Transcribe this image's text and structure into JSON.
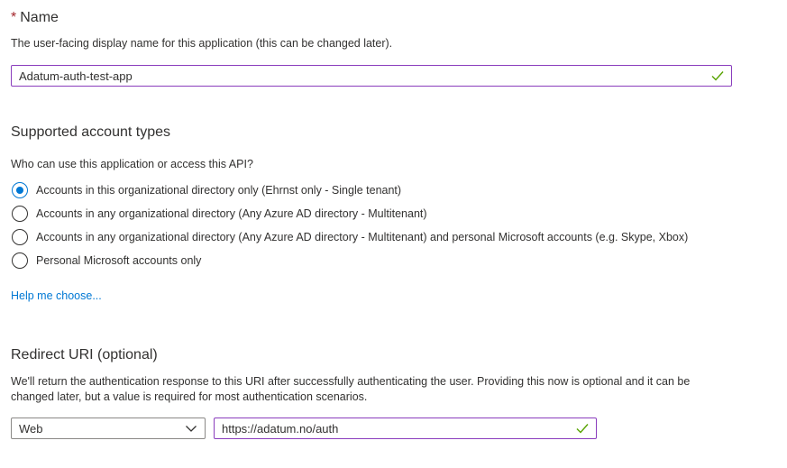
{
  "name_section": {
    "required_marker": "*",
    "title": "Name",
    "description": "The user-facing display name for this application (this can be changed later).",
    "input_value": "Adatum-auth-test-app"
  },
  "account_types": {
    "title": "Supported account types",
    "question": "Who can use this application or access this API?",
    "options": [
      {
        "label": "Accounts in this organizational directory only (Ehrnst only - Single tenant)",
        "selected": true
      },
      {
        "label": "Accounts in any organizational directory (Any Azure AD directory - Multitenant)",
        "selected": false
      },
      {
        "label": "Accounts in any organizational directory (Any Azure AD directory - Multitenant) and personal Microsoft accounts (e.g. Skype, Xbox)",
        "selected": false
      },
      {
        "label": "Personal Microsoft accounts only",
        "selected": false
      }
    ],
    "help_link": "Help me choose..."
  },
  "redirect_uri": {
    "title": "Redirect URI (optional)",
    "description_line1": "We'll return the authentication response to this URI after successfully authenticating the user. Providing this now is optional and it can be",
    "description_line2": "changed later, but a value is required for most authentication scenarios.",
    "platform_value": "Web",
    "uri_value": "https://adatum.no/auth"
  },
  "colors": {
    "accent": "#0078d4",
    "focus_border": "#8a3dbd",
    "valid_check": "#57a300",
    "required": "#a4262c"
  },
  "icons": {
    "valid": "checkmark-icon",
    "dropdown": "chevron-down-icon"
  }
}
